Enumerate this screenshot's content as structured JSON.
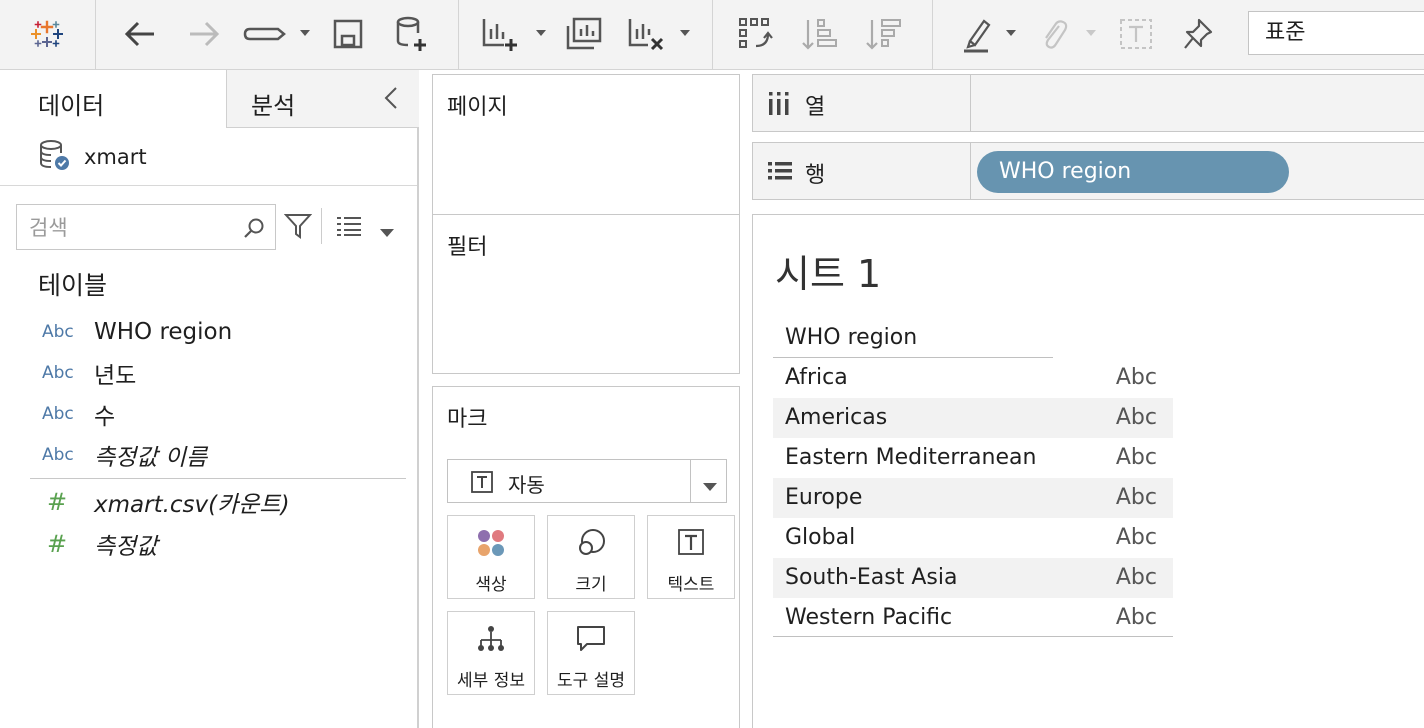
{
  "toolbar": {
    "zoom_value": "표준"
  },
  "data_pane": {
    "tabs": [
      "데이터",
      "분석"
    ],
    "datasource": "xmart",
    "search_placeholder": "검색",
    "tables_heading": "테이블",
    "fields": [
      {
        "type": "Abc",
        "name": "WHO region",
        "italic": false
      },
      {
        "type": "Abc",
        "name": "년도",
        "italic": false
      },
      {
        "type": "Abc",
        "name": "수",
        "italic": false
      },
      {
        "type": "Abc",
        "name": "측정값 이름",
        "italic": true
      }
    ],
    "measures": [
      {
        "type": "#",
        "name": "xmart.csv(카운트)",
        "italic": true
      },
      {
        "type": "#",
        "name": "측정값",
        "italic": true
      }
    ]
  },
  "cards": {
    "pages": "페이지",
    "filters": "필터",
    "marks": {
      "title": "마크",
      "type": "자동",
      "buttons": [
        "색상",
        "크기",
        "텍스트",
        "세부 정보",
        "도구 설명"
      ]
    }
  },
  "shelves": {
    "columns_label": "열",
    "rows_label": "행",
    "rows_pill": "WHO region"
  },
  "view": {
    "sheet_title": "시트 1",
    "column_header": "WHO region",
    "rows": [
      {
        "label": "Africa",
        "value": "Abc"
      },
      {
        "label": "Americas",
        "value": "Abc"
      },
      {
        "label": "Eastern Mediterranean",
        "value": "Abc"
      },
      {
        "label": "Europe",
        "value": "Abc"
      },
      {
        "label": "Global",
        "value": "Abc"
      },
      {
        "label": "South-East Asia",
        "value": "Abc"
      },
      {
        "label": "Western Pacific",
        "value": "Abc"
      }
    ]
  },
  "icons": {
    "toolbar": [
      "tableau-logo-icon",
      "undo-icon",
      "redo-icon",
      "replay-icon",
      "save-icon",
      "new-datasource-icon",
      "new-worksheet-icon",
      "duplicate-sheet-icon",
      "clear-sheet-icon",
      "swap-icon",
      "sort-ascending-icon",
      "sort-descending-icon",
      "highlight-icon",
      "attach-icon",
      "text-label-icon",
      "pin-icon"
    ],
    "colors": {
      "pill": "#6794b0",
      "dimension": "#4e79a7",
      "measure": "#59a14f"
    }
  }
}
